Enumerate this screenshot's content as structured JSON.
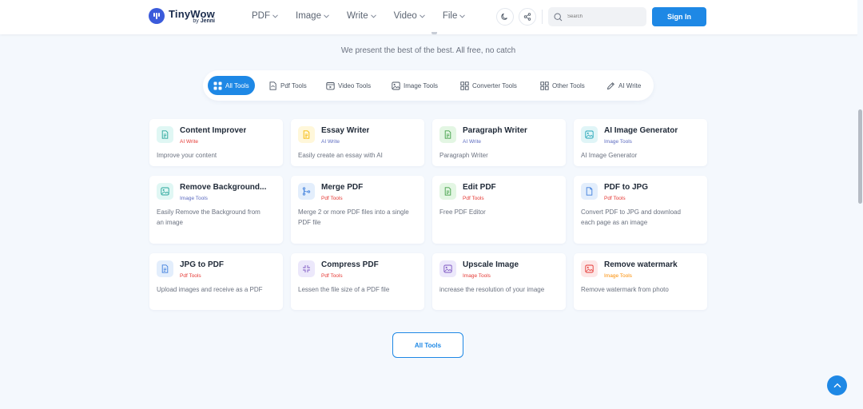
{
  "brand": {
    "title": "TinyWow",
    "sub_prefix": "by",
    "sub_name": "Jenni",
    "color": "#3b5bdb"
  },
  "nav": {
    "items": [
      {
        "label": "PDF"
      },
      {
        "label": "Image"
      },
      {
        "label": "Write"
      },
      {
        "label": "Video"
      },
      {
        "label": "File"
      }
    ]
  },
  "header": {
    "search_placeholder": "Search",
    "signin_label": "Sign In",
    "accent": "#1e88e5"
  },
  "hero": {
    "tagline": "We present the best of the best. All free, no catch"
  },
  "filters": [
    {
      "label": "All Tools",
      "icon": "grid-icon",
      "active": true
    },
    {
      "label": "Pdf Tools",
      "icon": "pdf-file-icon"
    },
    {
      "label": "Video Tools",
      "icon": "video-icon"
    },
    {
      "label": "Image Tools",
      "icon": "image-icon"
    },
    {
      "label": "Converter Tools",
      "icon": "converter-grid-icon"
    },
    {
      "label": "Other Tools",
      "icon": "other-grid-icon"
    },
    {
      "label": "AI Write",
      "icon": "pen-icon"
    }
  ],
  "cards": [
    {
      "title": "Content Improver",
      "category": "AI Write",
      "cat_color": "#e53935",
      "desc": "Improve your content",
      "icon": "document-icon",
      "icon_bg": "#e0f7f4",
      "icon_color": "#26a69a"
    },
    {
      "title": "Essay Writer",
      "category": "AI Write",
      "cat_color": "#5c6bc0",
      "desc": "Easily create an essay with AI",
      "icon": "document-icon",
      "icon_bg": "#fff7da",
      "icon_color": "#f5b700"
    },
    {
      "title": "Paragraph Writer",
      "category": "AI Write",
      "cat_color": "#5c6bc0",
      "desc": "Paragraph Writer",
      "icon": "document-icon",
      "icon_bg": "#e3f6e3",
      "icon_color": "#43a047"
    },
    {
      "title": "AI Image Generator",
      "category": "Image Tools",
      "cat_color": "#5c6bc0",
      "desc": "AI Image Generator",
      "icon": "image-icon",
      "icon_bg": "#e0f5f7",
      "icon_color": "#26a6b8"
    },
    {
      "title": "Remove Background...",
      "category": "Image Tools",
      "cat_color": "#5c6bc0",
      "desc": "Easily Remove the Background from an image",
      "icon": "image-icon",
      "icon_bg": "#e0f7f4",
      "icon_color": "#26a69a"
    },
    {
      "title": "Merge PDF",
      "category": "Pdf Tools",
      "cat_color": "#e53935",
      "desc": "Merge 2 or more PDF files into a single PDF file",
      "icon": "merge-icon",
      "icon_bg": "#e3eefc",
      "icon_color": "#3f7fdc"
    },
    {
      "title": "Edit PDF",
      "category": "Pdf Tools",
      "cat_color": "#e53935",
      "desc": "Free PDF Editor",
      "icon": "document-icon",
      "icon_bg": "#e3f6e3",
      "icon_color": "#43a047"
    },
    {
      "title": "PDF to JPG",
      "category": "Pdf Tools",
      "cat_color": "#e53935",
      "desc": "Convert PDF to JPG and download each page as an image",
      "icon": "file-icon",
      "icon_bg": "#e3eefc",
      "icon_color": "#3f7fdc"
    },
    {
      "title": "JPG to PDF",
      "category": "Pdf Tools",
      "cat_color": "#e53935",
      "desc": "Upload images and receive as a PDF",
      "icon": "document-icon",
      "icon_bg": "#e3eefc",
      "icon_color": "#3f7fdc"
    },
    {
      "title": "Compress PDF",
      "category": "Pdf Tools",
      "cat_color": "#e53935",
      "desc": "Lessen the file size of a PDF file",
      "icon": "compress-icon",
      "icon_bg": "#ece8fb",
      "icon_color": "#7e57c2"
    },
    {
      "title": "Upscale Image",
      "category": "Image Tools",
      "cat_color": "#e53935",
      "desc": "increase the resolution of your image",
      "icon": "image-icon",
      "icon_bg": "#ece8fb",
      "icon_color": "#7e57c2"
    },
    {
      "title": "Remove watermark",
      "category": "Image Tools",
      "cat_color": "#fb8c00",
      "desc": "Remove watermark from photo",
      "icon": "image-icon",
      "icon_bg": "#fde7e7",
      "icon_color": "#e53935"
    }
  ],
  "footer": {
    "all_tools_label": "All Tools"
  }
}
